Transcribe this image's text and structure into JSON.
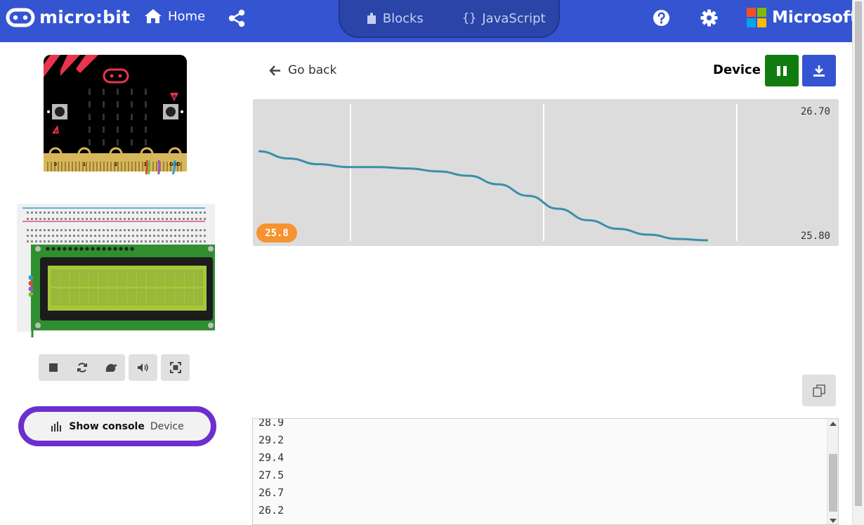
{
  "header": {
    "brand": "micro:bit",
    "home_label": "Home",
    "tabs": [
      {
        "label": "Blocks",
        "icon": "puzzle-icon"
      },
      {
        "label": "JavaScript",
        "icon": "braces-icon"
      }
    ],
    "microsoft_label": "Microsoft",
    "colors": {
      "bar": "#3454d1",
      "toggle": "#2a44a8"
    }
  },
  "simulator": {
    "pin_labels": [
      "0",
      "1",
      "2",
      "3V",
      "GND"
    ],
    "button_labels": [
      "A",
      "B"
    ],
    "controls": [
      "stop-icon",
      "restart-icon",
      "slow-motion-icon",
      "mute-icon",
      "fullscreen-icon"
    ],
    "console_button": {
      "label": "Show console",
      "sub": "Device"
    }
  },
  "serial": {
    "go_back": "Go back",
    "source_label": "Device",
    "copy_icon": "copy-icon",
    "console_lines": [
      "28.9",
      "29.2",
      "29.4",
      "27.5",
      "26.7",
      "26.2"
    ]
  },
  "chart_data": {
    "type": "line",
    "title": "",
    "xlabel": "",
    "ylabel": "",
    "ylim": [
      25.8,
      26.7
    ],
    "max_label": "26.70",
    "min_label": "25.80",
    "current_value": "25.8",
    "grid": "vertical",
    "series": [
      {
        "color": "#3a8fa8",
        "values": [
          26.42,
          26.37,
          26.33,
          26.31,
          26.31,
          26.3,
          26.28,
          26.25,
          26.19,
          26.11,
          26.02,
          25.94,
          25.88,
          25.84,
          25.81,
          25.8
        ]
      }
    ]
  }
}
